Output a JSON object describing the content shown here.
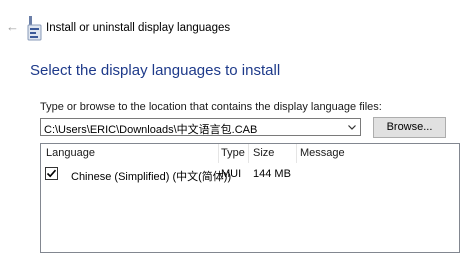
{
  "window": {
    "title": "Install or uninstall display languages"
  },
  "page": {
    "heading": "Select the display languages to install",
    "prompt": "Type or browse to the location that contains the display language files:",
    "path_value": "C:\\Users\\ERIC\\Downloads\\中文语言包.CAB",
    "browse_label": "Browse..."
  },
  "list": {
    "columns": [
      "Language",
      "Type",
      "Size",
      "Message"
    ],
    "rows": [
      {
        "checked": true,
        "language": "Chinese (Simplified) (中文(简体))",
        "type": "MUI",
        "size": "144 MB",
        "message": ""
      }
    ]
  },
  "colors": {
    "heading": "#1e3a8a",
    "border": "#828790",
    "button_bg": "#e1e1e1"
  },
  "icons": {
    "back": "back-arrow-icon",
    "app": "display-language-icon",
    "dropdown": "chevron-down-icon",
    "check": "checkmark-icon"
  }
}
